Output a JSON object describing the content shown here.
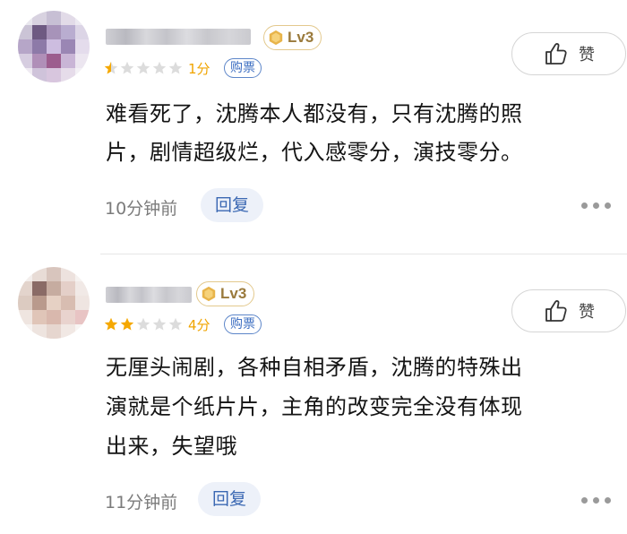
{
  "comments": [
    {
      "level": "Lv3",
      "rating_stars": 1,
      "score": "1分",
      "ticket_label": "购票",
      "like_label": "赞",
      "content_lines": [
        "难看死了，沈腾本人都没有，只有沈腾的照",
        "片，剧情超级烂，代入感零分，演技零分。"
      ],
      "time": "10分钟前",
      "reply_label": "回复"
    },
    {
      "level": "Lv3",
      "rating_stars": 2,
      "score": "4分",
      "ticket_label": "购票",
      "like_label": "赞",
      "content_lines": [
        "无厘头闹剧，各种自相矛盾，沈腾的特殊出",
        "演就是个纸片片，主角的改变完全没有体现",
        "出来，失望哦"
      ],
      "time": "11分钟前",
      "reply_label": "回复"
    }
  ],
  "colors": {
    "star_filled": "#f5a800",
    "star_empty": "#dcdcdc",
    "ticket_border": "#5d86c9",
    "reply_bg": "#edf1f9",
    "level_border": "#e3c98d"
  },
  "icons": {
    "level": "hexagon-badge-icon",
    "like": "thumbs-up-icon",
    "more": "more-dots-icon",
    "star": "star-icon"
  }
}
